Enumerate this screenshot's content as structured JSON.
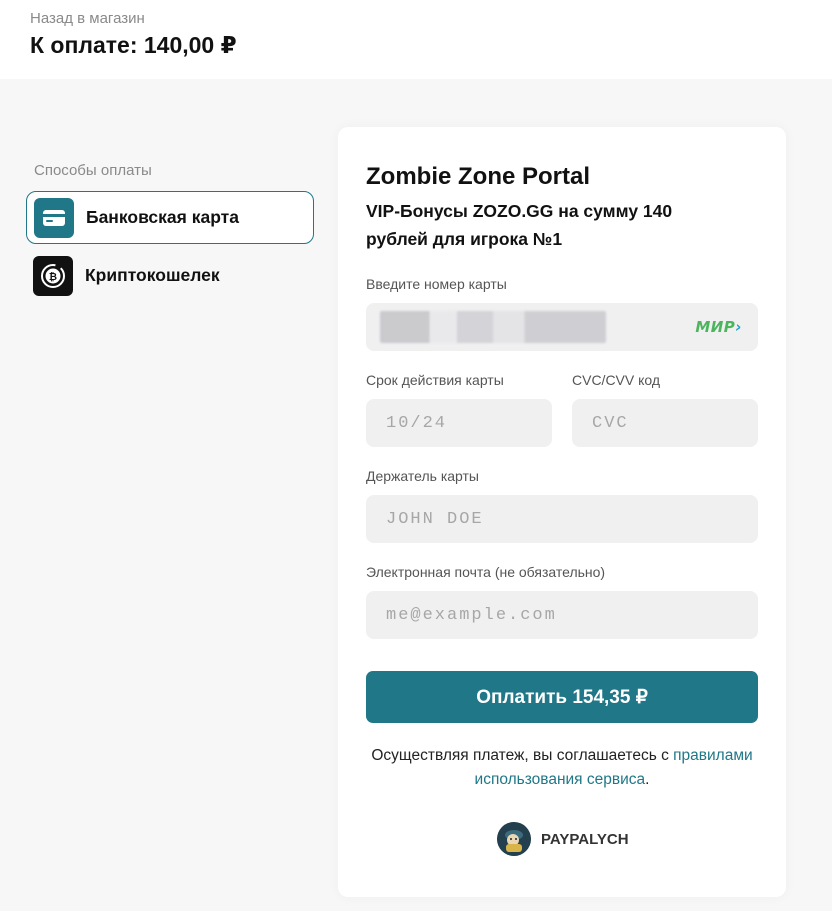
{
  "header": {
    "back_label": "Назад в магазин",
    "amount_title": "К оплате: 140,00 ₽"
  },
  "methods": {
    "title": "Способы оплаты",
    "items": [
      {
        "label": "Банковская карта",
        "icon": "credit-card-icon",
        "active": true
      },
      {
        "label": "Криптокошелек",
        "icon": "bitcoin-icon",
        "active": false
      }
    ]
  },
  "form": {
    "merchant": "Zombie Zone Portal",
    "description": "VIP-Бонусы ZOZO.GG на сумму 140 рублей для игрока №1",
    "card_number_label": "Введите номер карты",
    "card_brand": "МИР",
    "expiry_label": "Срок действия карты",
    "expiry_placeholder": "10/24",
    "cvc_label": "CVC/CVV код",
    "cvc_placeholder": "CVC",
    "holder_label": "Держатель карты",
    "holder_placeholder": "JOHN DOE",
    "email_label": "Электронная почта (не обязательно)",
    "email_placeholder": "me@example.com",
    "pay_label": "Оплатить 154,35 ₽",
    "terms_prefix": "Осуществляя платеж, вы соглашаетесь с ",
    "terms_link": "правилами использования сервиса",
    "terms_suffix": ".",
    "brand_name": "PAYPALYCH"
  },
  "colors": {
    "accent": "#1f7787",
    "background": "#f7f7f8",
    "input_bg": "#f0f0f1",
    "mir_green": "#4db45e"
  }
}
